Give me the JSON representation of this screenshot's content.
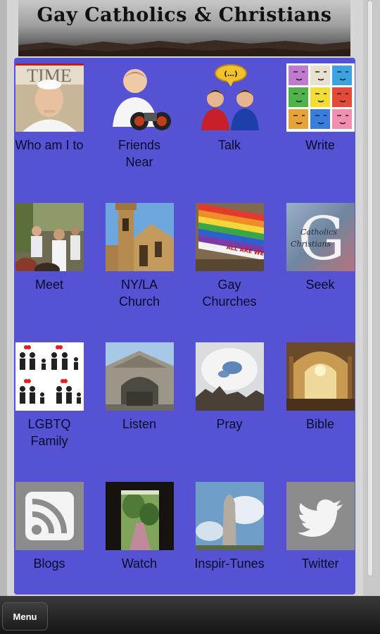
{
  "header": {
    "title": "Gay Catholics & Christians"
  },
  "tiles": [
    {
      "label": "Who am I to",
      "icon": "time-magazine-pope-image"
    },
    {
      "label": "Friends Near",
      "icon": "binoculars-person-image"
    },
    {
      "label": "Talk",
      "icon": "chat-people-image"
    },
    {
      "label": "Write",
      "icon": "faces-grid-image"
    },
    {
      "label": "Meet",
      "icon": "group-meeting-photo"
    },
    {
      "label": "NY/LA Church",
      "icon": "church-tower-photo"
    },
    {
      "label": "Gay Churches",
      "icon": "rainbow-flag-photo",
      "flag_text": "ALL ARE WE"
    },
    {
      "label": "Seek",
      "icon": "letter-g-logo",
      "logo_text_1": "Catholics",
      "logo_text_2": "Christians",
      "logo_letter": "G"
    },
    {
      "label": "LGBTQ Family",
      "icon": "family-pictogram-image"
    },
    {
      "label": "Listen",
      "icon": "cathedral-facade-photo"
    },
    {
      "label": "Pray",
      "icon": "sky-clouds-photo"
    },
    {
      "label": "Bible",
      "icon": "church-interior-photo"
    },
    {
      "label": "Blogs",
      "icon": "rss-icon"
    },
    {
      "label": "Watch",
      "icon": "doorway-garden-photo"
    },
    {
      "label": "Inspir-Tunes",
      "icon": "rock-pillar-sky-photo"
    },
    {
      "label": "Twitter",
      "icon": "twitter-bird-icon"
    }
  ],
  "bottom": {
    "menu_label": "Menu"
  },
  "colors": {
    "panel": "#5553d3",
    "label_text": "#0a0a2a"
  }
}
